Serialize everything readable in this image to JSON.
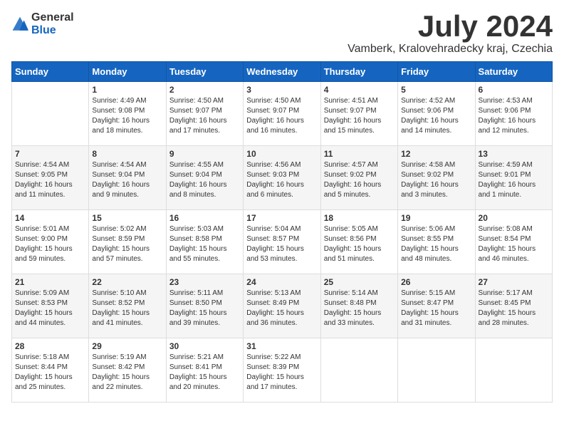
{
  "header": {
    "logo_general": "General",
    "logo_blue": "Blue",
    "title": "July 2024",
    "subtitle": "Vamberk, Kralovehradecky kraj, Czechia"
  },
  "days_of_week": [
    "Sunday",
    "Monday",
    "Tuesday",
    "Wednesday",
    "Thursday",
    "Friday",
    "Saturday"
  ],
  "weeks": [
    [
      {
        "num": "",
        "info": ""
      },
      {
        "num": "1",
        "info": "Sunrise: 4:49 AM\nSunset: 9:08 PM\nDaylight: 16 hours\nand 18 minutes."
      },
      {
        "num": "2",
        "info": "Sunrise: 4:50 AM\nSunset: 9:07 PM\nDaylight: 16 hours\nand 17 minutes."
      },
      {
        "num": "3",
        "info": "Sunrise: 4:50 AM\nSunset: 9:07 PM\nDaylight: 16 hours\nand 16 minutes."
      },
      {
        "num": "4",
        "info": "Sunrise: 4:51 AM\nSunset: 9:07 PM\nDaylight: 16 hours\nand 15 minutes."
      },
      {
        "num": "5",
        "info": "Sunrise: 4:52 AM\nSunset: 9:06 PM\nDaylight: 16 hours\nand 14 minutes."
      },
      {
        "num": "6",
        "info": "Sunrise: 4:53 AM\nSunset: 9:06 PM\nDaylight: 16 hours\nand 12 minutes."
      }
    ],
    [
      {
        "num": "7",
        "info": "Sunrise: 4:54 AM\nSunset: 9:05 PM\nDaylight: 16 hours\nand 11 minutes."
      },
      {
        "num": "8",
        "info": "Sunrise: 4:54 AM\nSunset: 9:04 PM\nDaylight: 16 hours\nand 9 minutes."
      },
      {
        "num": "9",
        "info": "Sunrise: 4:55 AM\nSunset: 9:04 PM\nDaylight: 16 hours\nand 8 minutes."
      },
      {
        "num": "10",
        "info": "Sunrise: 4:56 AM\nSunset: 9:03 PM\nDaylight: 16 hours\nand 6 minutes."
      },
      {
        "num": "11",
        "info": "Sunrise: 4:57 AM\nSunset: 9:02 PM\nDaylight: 16 hours\nand 5 minutes."
      },
      {
        "num": "12",
        "info": "Sunrise: 4:58 AM\nSunset: 9:02 PM\nDaylight: 16 hours\nand 3 minutes."
      },
      {
        "num": "13",
        "info": "Sunrise: 4:59 AM\nSunset: 9:01 PM\nDaylight: 16 hours\nand 1 minute."
      }
    ],
    [
      {
        "num": "14",
        "info": "Sunrise: 5:01 AM\nSunset: 9:00 PM\nDaylight: 15 hours\nand 59 minutes."
      },
      {
        "num": "15",
        "info": "Sunrise: 5:02 AM\nSunset: 8:59 PM\nDaylight: 15 hours\nand 57 minutes."
      },
      {
        "num": "16",
        "info": "Sunrise: 5:03 AM\nSunset: 8:58 PM\nDaylight: 15 hours\nand 55 minutes."
      },
      {
        "num": "17",
        "info": "Sunrise: 5:04 AM\nSunset: 8:57 PM\nDaylight: 15 hours\nand 53 minutes."
      },
      {
        "num": "18",
        "info": "Sunrise: 5:05 AM\nSunset: 8:56 PM\nDaylight: 15 hours\nand 51 minutes."
      },
      {
        "num": "19",
        "info": "Sunrise: 5:06 AM\nSunset: 8:55 PM\nDaylight: 15 hours\nand 48 minutes."
      },
      {
        "num": "20",
        "info": "Sunrise: 5:08 AM\nSunset: 8:54 PM\nDaylight: 15 hours\nand 46 minutes."
      }
    ],
    [
      {
        "num": "21",
        "info": "Sunrise: 5:09 AM\nSunset: 8:53 PM\nDaylight: 15 hours\nand 44 minutes."
      },
      {
        "num": "22",
        "info": "Sunrise: 5:10 AM\nSunset: 8:52 PM\nDaylight: 15 hours\nand 41 minutes."
      },
      {
        "num": "23",
        "info": "Sunrise: 5:11 AM\nSunset: 8:50 PM\nDaylight: 15 hours\nand 39 minutes."
      },
      {
        "num": "24",
        "info": "Sunrise: 5:13 AM\nSunset: 8:49 PM\nDaylight: 15 hours\nand 36 minutes."
      },
      {
        "num": "25",
        "info": "Sunrise: 5:14 AM\nSunset: 8:48 PM\nDaylight: 15 hours\nand 33 minutes."
      },
      {
        "num": "26",
        "info": "Sunrise: 5:15 AM\nSunset: 8:47 PM\nDaylight: 15 hours\nand 31 minutes."
      },
      {
        "num": "27",
        "info": "Sunrise: 5:17 AM\nSunset: 8:45 PM\nDaylight: 15 hours\nand 28 minutes."
      }
    ],
    [
      {
        "num": "28",
        "info": "Sunrise: 5:18 AM\nSunset: 8:44 PM\nDaylight: 15 hours\nand 25 minutes."
      },
      {
        "num": "29",
        "info": "Sunrise: 5:19 AM\nSunset: 8:42 PM\nDaylight: 15 hours\nand 22 minutes."
      },
      {
        "num": "30",
        "info": "Sunrise: 5:21 AM\nSunset: 8:41 PM\nDaylight: 15 hours\nand 20 minutes."
      },
      {
        "num": "31",
        "info": "Sunrise: 5:22 AM\nSunset: 8:39 PM\nDaylight: 15 hours\nand 17 minutes."
      },
      {
        "num": "",
        "info": ""
      },
      {
        "num": "",
        "info": ""
      },
      {
        "num": "",
        "info": ""
      }
    ]
  ]
}
